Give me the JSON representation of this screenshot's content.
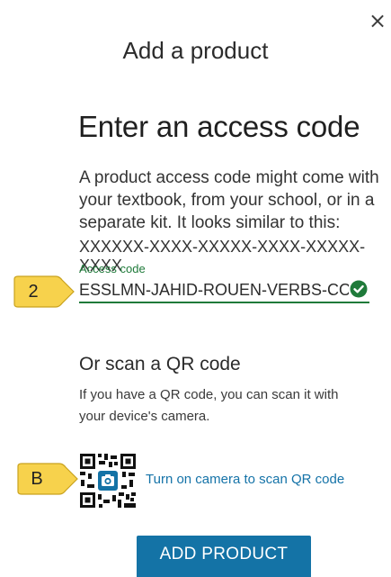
{
  "dialog": {
    "title": "Add a product",
    "close_label": "×"
  },
  "access_code_section": {
    "heading": "Enter an access code",
    "description": "A product access code might come with your textbook, from your school, or in a separate kit. It looks similar to this:",
    "sample_code": "XXXXXX-XXXX-XXXXX-XXXX-XXXXX-XXXX",
    "field": {
      "label": "Access code",
      "value": "ESSLMN-JAHID-ROUEN-VERBS-CONT(",
      "status": "valid",
      "status_icon": "check-circle-icon"
    }
  },
  "qr_section": {
    "heading": "Or scan a QR code",
    "description": "If you have a QR code, you can scan it with your device's camera.",
    "icon": "qr-camera-icon",
    "camera_link": "Turn on camera to scan QR code"
  },
  "primary_action": {
    "label": "ADD PRODUCT"
  },
  "annotations": {
    "callout_access_code": "2",
    "callout_qr": "B"
  },
  "colors": {
    "accent_blue": "#1473a6",
    "link_blue": "#1573a8",
    "valid_green": "#1f7a3a",
    "callout_yellow": "#f7d24c"
  }
}
